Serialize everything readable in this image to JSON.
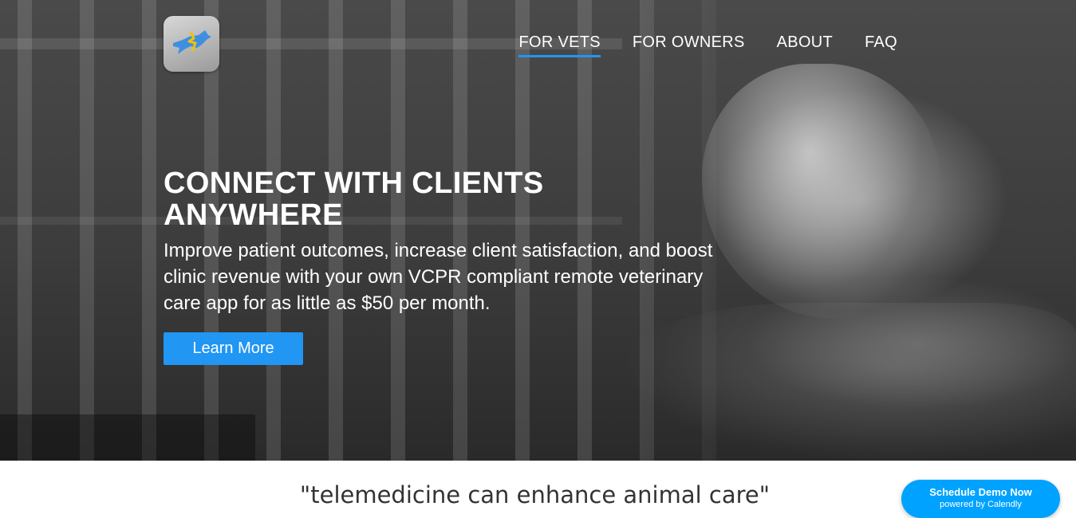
{
  "header": {
    "logo_icon": "running-dog-icon",
    "nav": [
      {
        "label": "FOR VETS",
        "active": true
      },
      {
        "label": "FOR OWNERS",
        "active": false
      },
      {
        "label": "ABOUT",
        "active": false
      },
      {
        "label": "FAQ",
        "active": false
      }
    ]
  },
  "hero": {
    "headline": "CONNECT WITH CLIENTS ANYWHERE",
    "subtext": "Improve patient outcomes, increase client satisfaction, and boost clinic revenue with your own VCPR compliant remote veterinary care app for as little as $50 per month.",
    "cta_label": "Learn More"
  },
  "quote": {
    "text": "\"telemedicine can enhance animal care\""
  },
  "calendly": {
    "title": "Schedule Demo Now",
    "subtitle": "powered by Calendly"
  },
  "colors": {
    "accent": "#2196f3",
    "calendly": "#00a2ff"
  }
}
